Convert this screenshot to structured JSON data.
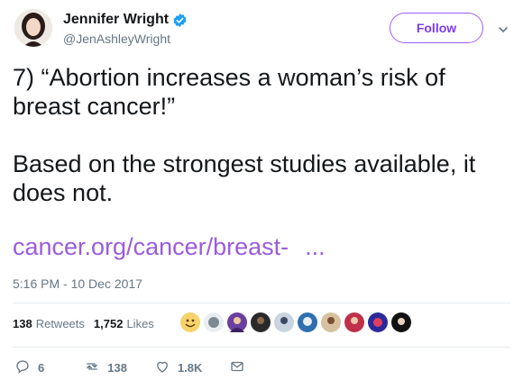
{
  "user": {
    "display_name": "Jennifer Wright",
    "handle": "@JenAshleyWright"
  },
  "follow_label": "Follow",
  "tweet": {
    "paragraph1": "7) “Abortion increases a woman’s risk of breast cancer!”",
    "paragraph2": "Based on the strongest studies available, it does not.",
    "link_text": "cancer.org/cancer/breast-",
    "link_ellipsis": "...",
    "timestamp": "5:16 PM - 10 Dec 2017"
  },
  "stats": {
    "retweets_count": "138",
    "retweets_label": "Retweets",
    "likes_count": "1,752",
    "likes_label": "Likes"
  },
  "actions": {
    "reply_count": "6",
    "retweet_count": "138",
    "like_count": "1.8K"
  },
  "colors": {
    "accent": "#9b5cdc",
    "verified": "#1da1f2",
    "muted": "#657786"
  }
}
